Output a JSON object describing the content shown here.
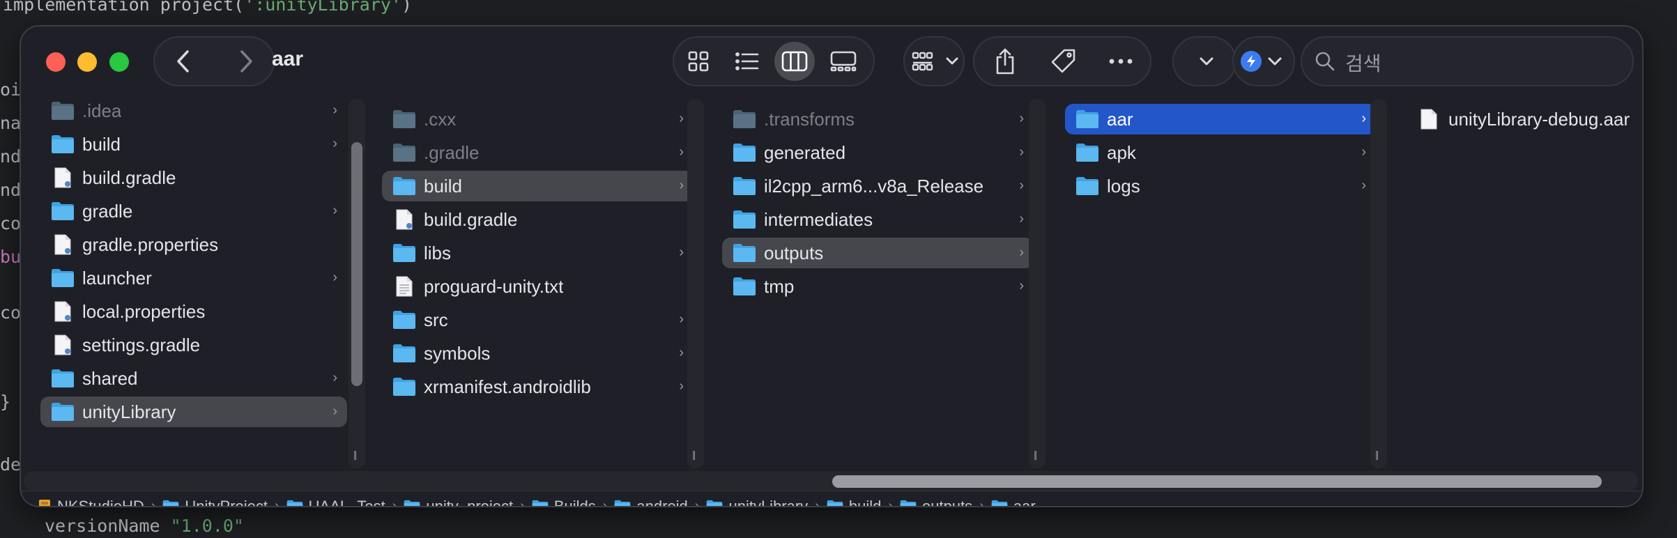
{
  "ide": {
    "top_line_prefix": "implementation project(",
    "top_line_string": "':unityLibrary'",
    "top_line_suffix": ")",
    "bottom_line_key": "versionName ",
    "bottom_line_value": "\"1.0.0\"",
    "left_fragments": [
      "oi",
      "na",
      "nd",
      "nd",
      "co",
      "bu",
      "co",
      "}",
      "de"
    ]
  },
  "finder": {
    "title": "aar",
    "search_placeholder": "검색",
    "icons": {
      "back": "chevron-left-icon",
      "forward": "chevron-right-icon",
      "icon_view": "grid-icon",
      "list_view": "list-icon",
      "column_view": "columns-icon",
      "gallery_view": "gallery-icon",
      "group": "group-icon",
      "share": "share-icon",
      "tag": "tag-icon",
      "more": "ellipsis-icon",
      "search": "search-icon"
    },
    "colors": {
      "selection_blue": "#2356c9",
      "folder_blue": "#5cb8f0"
    },
    "columns": [
      {
        "items": [
          {
            "label": ".idea",
            "type": "folder",
            "chevron": true,
            "dim": true
          },
          {
            "label": "build",
            "type": "folder",
            "chevron": true
          },
          {
            "label": "build.gradle",
            "type": "doc"
          },
          {
            "label": "gradle",
            "type": "folder",
            "chevron": true
          },
          {
            "label": "gradle.properties",
            "type": "doc"
          },
          {
            "label": "launcher",
            "type": "folder",
            "chevron": true
          },
          {
            "label": "local.properties",
            "type": "doc"
          },
          {
            "label": "settings.gradle",
            "type": "doc"
          },
          {
            "label": "shared",
            "type": "folder",
            "chevron": true
          },
          {
            "label": "unityLibrary",
            "type": "folder",
            "chevron": true,
            "selected": true
          }
        ]
      },
      {
        "items": [
          {
            "label": ".cxx",
            "type": "folder",
            "chevron": true,
            "dim": true
          },
          {
            "label": ".gradle",
            "type": "folder",
            "chevron": true,
            "dim": true
          },
          {
            "label": "build",
            "type": "folder",
            "chevron": true,
            "selected": true
          },
          {
            "label": "build.gradle",
            "type": "doc"
          },
          {
            "label": "libs",
            "type": "folder",
            "chevron": true
          },
          {
            "label": "proguard-unity.txt",
            "type": "txt"
          },
          {
            "label": "src",
            "type": "folder",
            "chevron": true
          },
          {
            "label": "symbols",
            "type": "folder",
            "chevron": true
          },
          {
            "label": "xrmanifest.androidlib",
            "type": "folder",
            "chevron": true
          }
        ]
      },
      {
        "items": [
          {
            "label": ".transforms",
            "type": "folder",
            "chevron": true,
            "dim": true
          },
          {
            "label": "generated",
            "type": "folder",
            "chevron": true
          },
          {
            "label": "il2cpp_arm6...v8a_Release",
            "type": "folder",
            "chevron": true
          },
          {
            "label": "intermediates",
            "type": "folder",
            "chevron": true
          },
          {
            "label": "outputs",
            "type": "folder",
            "chevron": true,
            "selected": true
          },
          {
            "label": "tmp",
            "type": "folder",
            "chevron": true
          }
        ]
      },
      {
        "items": [
          {
            "label": "aar",
            "type": "folder",
            "chevron": true,
            "active": true
          },
          {
            "label": "apk",
            "type": "folder",
            "chevron": true
          },
          {
            "label": "logs",
            "type": "folder",
            "chevron": true
          }
        ]
      },
      {
        "items": [
          {
            "label": "unityLibrary-debug.aar",
            "type": "file"
          }
        ]
      }
    ],
    "path": [
      {
        "label": "NKStudioHD",
        "type": "home"
      },
      {
        "label": "UnityProject",
        "type": "folder"
      },
      {
        "label": "UAAL_Test",
        "type": "folder"
      },
      {
        "label": "unity_project",
        "type": "folder"
      },
      {
        "label": "Builds",
        "type": "folder"
      },
      {
        "label": "android",
        "type": "folder"
      },
      {
        "label": "unityLibrary",
        "type": "folder"
      },
      {
        "label": "build",
        "type": "folder"
      },
      {
        "label": "outputs",
        "type": "folder"
      },
      {
        "label": "aar",
        "type": "folder"
      }
    ],
    "path_separator": "›",
    "chevron_glyph": "›"
  }
}
